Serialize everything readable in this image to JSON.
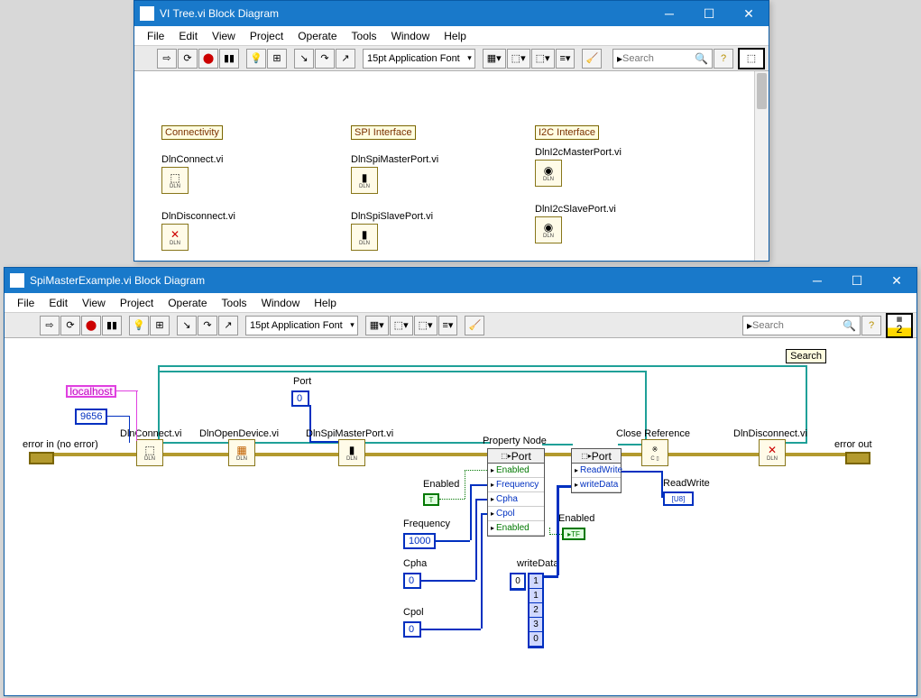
{
  "win1": {
    "title": "VI Tree.vi Block Diagram",
    "menu": [
      "File",
      "Edit",
      "View",
      "Project",
      "Operate",
      "Tools",
      "Window",
      "Help"
    ],
    "font": "15pt Application Font",
    "search_ph": "Search",
    "cats": {
      "connectivity": "Connectivity",
      "spi": "SPI Interface",
      "i2c": "I2C Interface"
    },
    "items": {
      "conn": "DlnConnect.vi",
      "disc": "DlnDisconnect.vi",
      "spim": "DlnSpiMasterPort.vi",
      "spis": "DlnSpiSlavePort.vi",
      "i2cm": "DlnI2cMasterPort.vi",
      "i2cs": "DlnI2cSlavePort.vi"
    }
  },
  "win2": {
    "title": "SpiMasterExample.vi Block Diagram",
    "menu": [
      "File",
      "Edit",
      "View",
      "Project",
      "Operate",
      "Tools",
      "Window",
      "Help"
    ],
    "font": "15pt Application Font",
    "search_ph": "Search",
    "searchtag": "Search",
    "labels": {
      "localhost": "localhost",
      "port9656": "9656",
      "errorin": "error in (no error)",
      "errorout": "error out",
      "portlbl": "Port",
      "portval": "0",
      "dlnconnect": "DlnConnect.vi",
      "dlnopen": "DlnOpenDevice.vi",
      "dlnspim": "DlnSpiMasterPort.vi",
      "closeref": "Close Reference",
      "dlndisc": "DlnDisconnect.vi",
      "propnode": "Property Node",
      "enabled": "Enabled",
      "freq": "Frequency",
      "freqval": "1000",
      "cpha": "Cpha",
      "cphaval": "0",
      "cpol": "Cpol",
      "cpolval": "0",
      "writedata": "writeData",
      "readwrite": "ReadWrite",
      "portcell": "Port"
    },
    "prop1_rows": [
      "Enabled",
      "Frequency",
      "Cpha",
      "Cpol",
      "Enabled"
    ],
    "prop2_rows": [
      "ReadWrite",
      "writeData"
    ],
    "array_idx": [
      "0"
    ],
    "array_vals": [
      "1",
      "1",
      "2",
      "3",
      "0"
    ]
  }
}
